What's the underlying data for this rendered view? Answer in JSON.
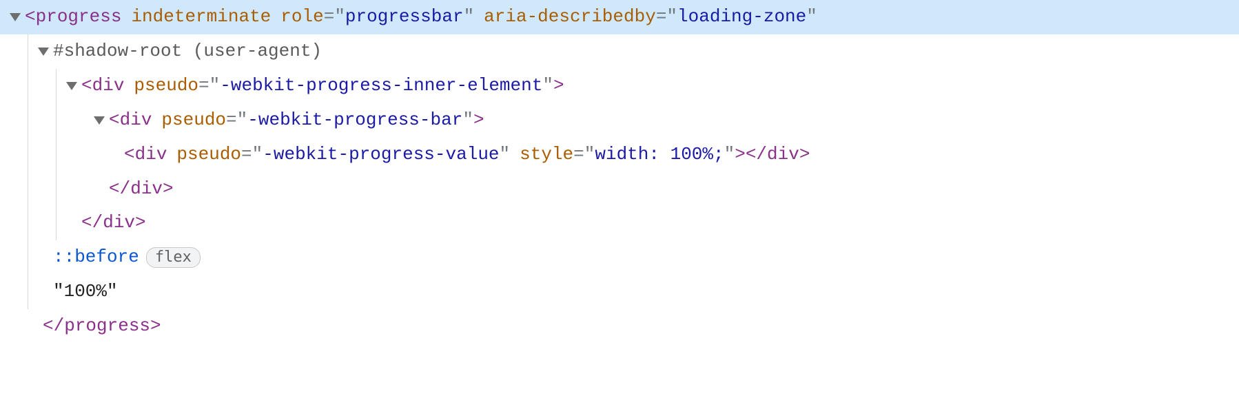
{
  "lines": {
    "l0": {
      "tag": "progress",
      "attr_indeterminate": "indeterminate",
      "attr_role_name": "role",
      "attr_role_val": "progressbar",
      "attr_desc_name": "aria-describedby",
      "attr_desc_val": "loading-zone"
    },
    "l1": {
      "shadow": "#shadow-root (user-agent)"
    },
    "l2": {
      "tag": "div",
      "attr_name": "pseudo",
      "attr_val": "-webkit-progress-inner-element"
    },
    "l3": {
      "tag": "div",
      "attr_name": "pseudo",
      "attr_val": "-webkit-progress-bar"
    },
    "l4": {
      "tag": "div",
      "attr_name": "pseudo",
      "attr_val": "-webkit-progress-value",
      "attr2_name": "style",
      "attr2_val": "width: 100%;",
      "close": "div"
    },
    "l5": {
      "close": "div"
    },
    "l6": {
      "close": "div"
    },
    "l7": {
      "pseudo": "::before",
      "pill": "flex"
    },
    "l8": {
      "text": "\"100%\""
    },
    "l9": {
      "close": "progress"
    }
  }
}
